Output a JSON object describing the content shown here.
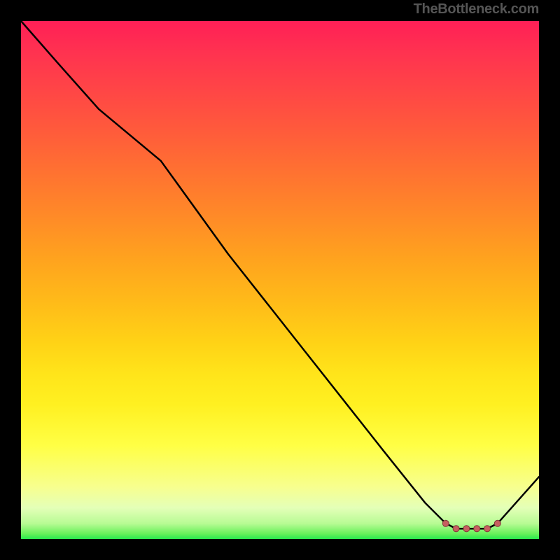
{
  "attribution": "TheBottleneck.com",
  "colors": {
    "background": "#000000",
    "curve": "#000000",
    "marker": "#c66060"
  },
  "chart_data": {
    "type": "line",
    "title": "",
    "xlabel": "",
    "ylabel": "",
    "xlim": [
      0,
      100
    ],
    "ylim": [
      0,
      100
    ],
    "x": [
      0,
      7,
      15,
      27,
      40,
      55,
      70,
      78,
      82,
      84,
      86,
      88,
      90,
      92,
      100
    ],
    "values": [
      100,
      92,
      83,
      73,
      55,
      36,
      17,
      7,
      3,
      2,
      2,
      2,
      2,
      3,
      12
    ],
    "markers": {
      "x": [
        82,
        84,
        86,
        88,
        90,
        92
      ],
      "values": [
        3,
        2,
        2,
        2,
        2,
        3
      ]
    }
  }
}
